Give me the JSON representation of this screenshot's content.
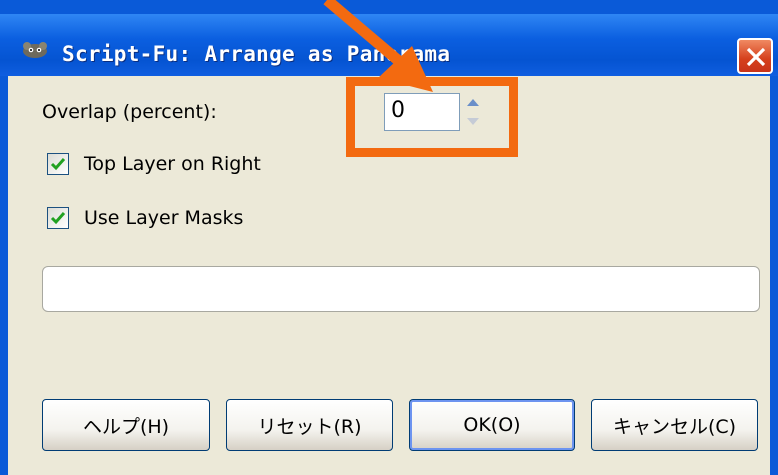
{
  "window": {
    "title": "Script-Fu: Arrange as Panorama",
    "app_icon": "gimp-icon",
    "close_icon": "close-icon"
  },
  "form": {
    "overlap_label": "Overlap (percent):",
    "overlap_value": "0",
    "top_layer_label": "Top Layer on Right",
    "top_layer_checked": true,
    "masks_label": "Use Layer Masks",
    "masks_checked": true
  },
  "buttons": {
    "help": "ヘルプ(H)",
    "reset": "リセット(R)",
    "ok": "OK(O)",
    "cancel": "キャンセル(C)"
  },
  "annotation": {
    "color": "#f36a10"
  }
}
